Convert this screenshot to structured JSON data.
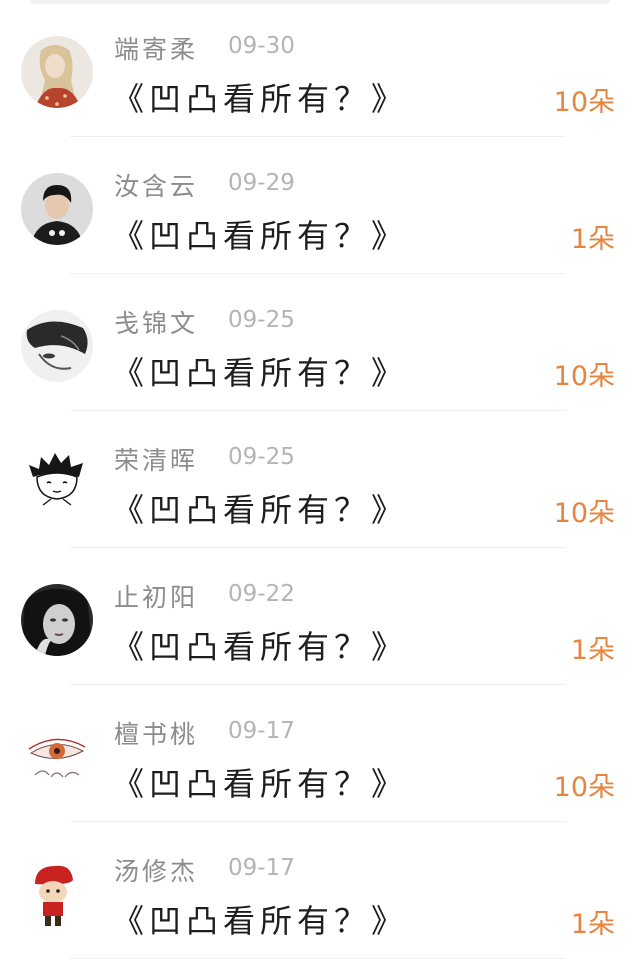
{
  "rows": [
    {
      "name": "端寄柔",
      "date": "09-30",
      "title": "《凹凸看所有？》",
      "count": "10朵",
      "avatar": "girl-drawing-avatar"
    },
    {
      "name": "汝含云",
      "date": "09-29",
      "title": "《凹凸看所有？》",
      "count": "1朵",
      "avatar": "boy-photo-avatar"
    },
    {
      "name": "戋锦文",
      "date": "09-25",
      "title": "《凹凸看所有？》",
      "count": "10朵",
      "avatar": "face-sketch-avatar"
    },
    {
      "name": "荣清晖",
      "date": "09-25",
      "title": "《凹凸看所有？》",
      "count": "10朵",
      "avatar": "cartoon-boy-avatar"
    },
    {
      "name": "止初阳",
      "date": "09-22",
      "title": "《凹凸看所有？》",
      "count": "1朵",
      "avatar": "woman-photo-avatar"
    },
    {
      "name": "檀书桃",
      "date": "09-17",
      "title": "《凹凸看所有？》",
      "count": "10朵",
      "avatar": "eye-sketch-avatar"
    },
    {
      "name": "汤修杰",
      "date": "09-17",
      "title": "《凹凸看所有？》",
      "count": "1朵",
      "avatar": "cartoon-chef-avatar"
    }
  ],
  "colors": {
    "name": "#8c8c8c",
    "date": "#b4b4b4",
    "title": "#1e1e1e",
    "count": "#e6853f",
    "divider": "#efefef"
  }
}
